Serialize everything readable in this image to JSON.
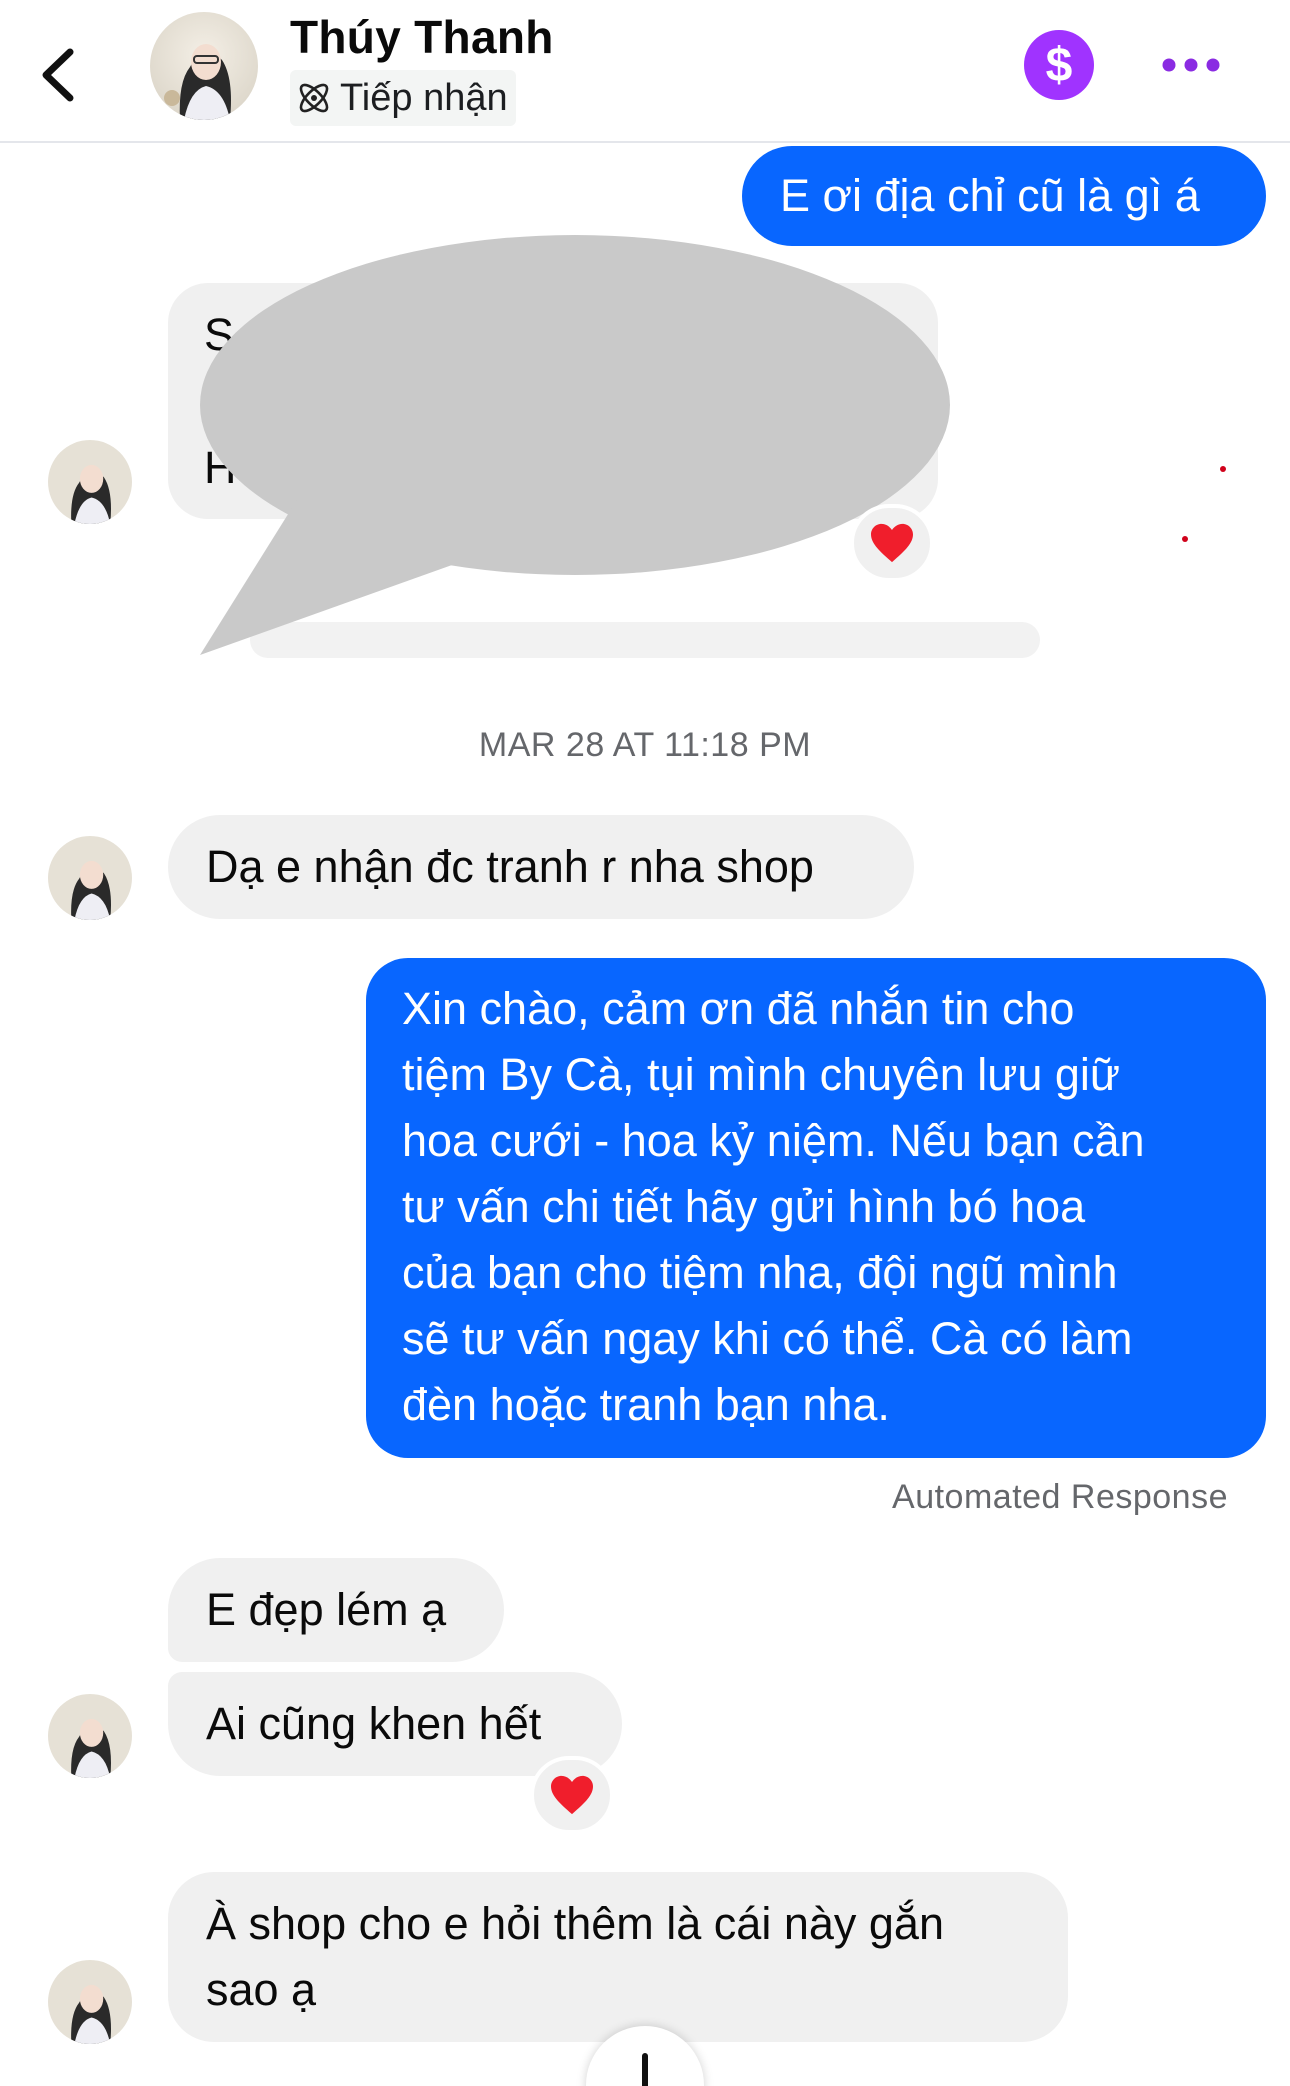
{
  "header": {
    "contact_name": "Thúy Thanh",
    "status": "Tiếp nhận",
    "dollar_symbol": "$"
  },
  "messages": {
    "outgoing_1": "E ơi địa chỉ cũ là gì á",
    "redacted_line_1_visible": "S",
    "redacted_line_2_visible": "H",
    "timestamp": "MAR 28 AT 11:18 PM",
    "incoming_1": "Dạ e nhận đc tranh r nha shop",
    "auto_reply_lines": [
      "Xin chào, cảm ơn đã nhắn tin cho",
      "tiệm By Cà, tụi mình chuyên lưu giữ",
      "hoa cưới - hoa kỷ niệm. Nếu bạn cần",
      "tư vấn chi tiết hãy gửi hình bó hoa",
      "của bạn cho tiệm nha, đội ngũ mình",
      "sẽ tư vấn ngay khi có thể. Cà có làm",
      "đèn hoặc tranh bạn nha."
    ],
    "auto_label": "Automated Response",
    "incoming_2": "E đẹp lém ạ",
    "incoming_3": "Ai cũng khen hết",
    "incoming_4_lines": [
      "À shop cho e hỏi thêm là cái này gắn",
      "sao ạ"
    ]
  },
  "colors": {
    "outgoing_bubble": "#0866ff",
    "incoming_bubble": "#f0f0f0",
    "dollar_button": "#a033ff",
    "more_dots": "#8a2be2",
    "redaction": "#c9c9c9"
  },
  "icons": {
    "back": "chevron-left-icon",
    "status": "atom-icon",
    "dollar": "dollar-icon",
    "more": "more-dots-icon",
    "reaction": "heart-icon"
  }
}
